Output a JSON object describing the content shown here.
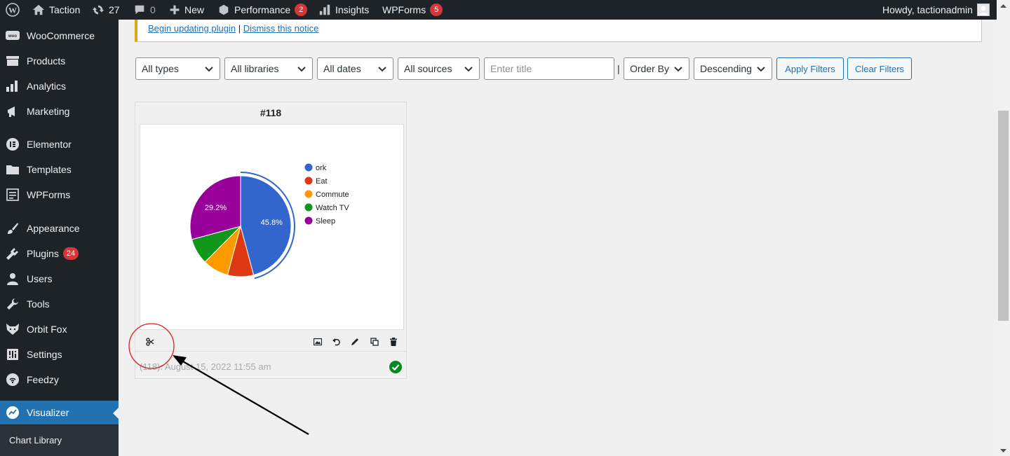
{
  "admin_bar": {
    "site_name": "Taction",
    "updates_count": "27",
    "comments_count": "0",
    "new_label": "New",
    "performance_label": "Performance",
    "performance_badge": "2",
    "insights_label": "Insights",
    "wpforms_label": "WPForms",
    "wpforms_badge": "5",
    "howdy": "Howdy, tactionadmin"
  },
  "sidebar": {
    "items": [
      {
        "label": "WooCommerce",
        "icon": "woo-icon"
      },
      {
        "label": "Products",
        "icon": "archive-icon"
      },
      {
        "label": "Analytics",
        "icon": "bar-chart-icon"
      },
      {
        "label": "Marketing",
        "icon": "megaphone-icon"
      },
      {
        "label": "Elementor",
        "icon": "elementor-icon"
      },
      {
        "label": "Templates",
        "icon": "folder-icon"
      },
      {
        "label": "WPForms",
        "icon": "form-icon"
      },
      {
        "label": "Appearance",
        "icon": "brush-icon"
      },
      {
        "label": "Plugins",
        "icon": "plugin-icon",
        "badge": "24"
      },
      {
        "label": "Users",
        "icon": "user-icon"
      },
      {
        "label": "Tools",
        "icon": "wrench-icon"
      },
      {
        "label": "Orbit Fox",
        "icon": "fox-icon"
      },
      {
        "label": "Settings",
        "icon": "settings-icon"
      },
      {
        "label": "Feedzy",
        "icon": "feed-icon"
      },
      {
        "label": "Visualizer",
        "icon": "chart-icon",
        "current": true
      }
    ],
    "submenu": {
      "label": "Chart Library"
    }
  },
  "notice": {
    "link_begin": "Begin updating plugin",
    "separator": "|",
    "link_dismiss": "Dismiss this notice",
    "border_color": "#dba617"
  },
  "filters": {
    "type": "All types",
    "library": "All libraries",
    "date": "All dates",
    "source": "All sources",
    "title_placeholder": "Enter title",
    "separator": "|",
    "order_by": "Order By",
    "direction": "Descending",
    "apply": "Apply Filters",
    "clear": "Clear Filters"
  },
  "card": {
    "title": "#118",
    "date": "(118): August 15, 2022 11:55 am",
    "status_icon": "check-circle-icon",
    "tools": [
      "scissors-icon",
      "image-icon",
      "undo-icon",
      "edit-icon",
      "copy-icon",
      "trash-icon"
    ]
  },
  "chart_data": {
    "type": "pie",
    "labels": [
      "ork",
      "Eat",
      "Commute",
      "Watch TV",
      "Sleep"
    ],
    "values": [
      45.8,
      8.3,
      8.3,
      8.3,
      29.2
    ],
    "colors": [
      "#3366cc",
      "#dc3912",
      "#ff9900",
      "#109618",
      "#990099"
    ],
    "slice_labels": [
      "45.8%",
      "",
      "",
      "",
      "29.2%"
    ],
    "selected_slice": "ork",
    "legend_position": "right"
  }
}
